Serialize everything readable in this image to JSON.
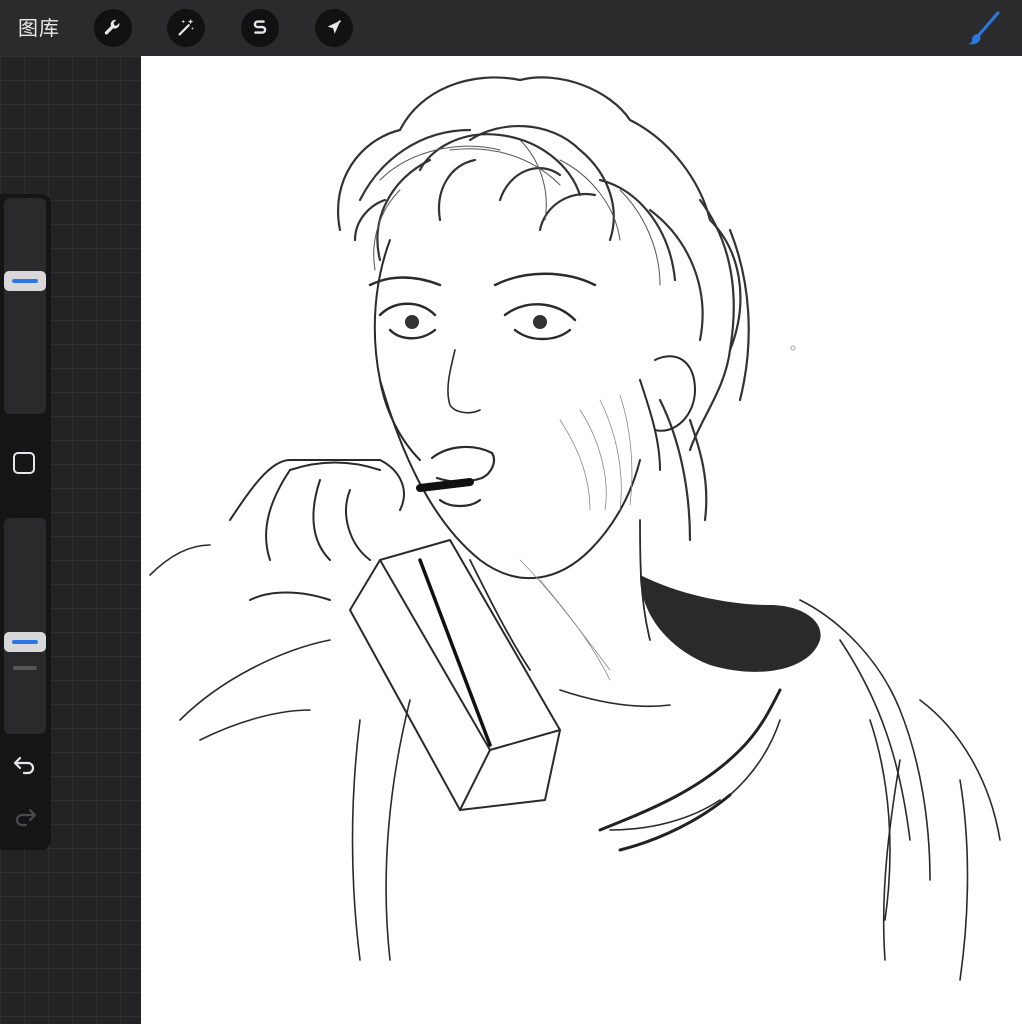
{
  "toolbar": {
    "gallery_label": "图库",
    "tools": [
      {
        "name": "actions",
        "icon": "wrench-icon"
      },
      {
        "name": "adjustments",
        "icon": "magic-wand-icon"
      },
      {
        "name": "selection",
        "icon": "selection-s-icon"
      },
      {
        "name": "transform",
        "icon": "arrow-cursor-icon"
      }
    ],
    "brush_icon": "brush-icon",
    "accent_color": "#2b78e4"
  },
  "sidebar": {
    "brush_size_level": 0.63,
    "opacity_level": 0.42,
    "modify_icon": "square-icon",
    "undo_icon": "undo-icon",
    "redo_icon": "redo-icon",
    "redo_enabled": false
  },
  "canvas": {
    "content": "pencil-sketch-drawing",
    "background": "#ffffff"
  }
}
